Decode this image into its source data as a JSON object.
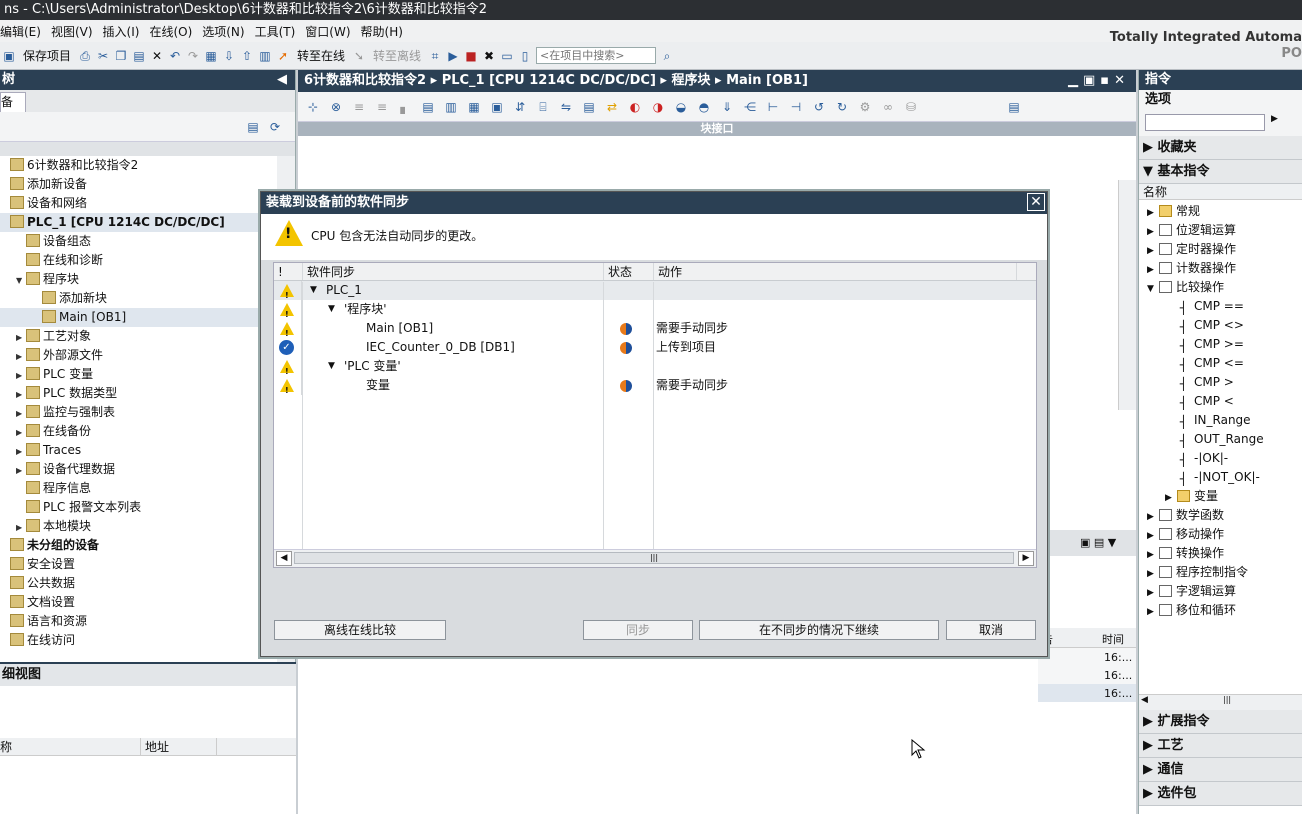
{
  "window": {
    "title": "ns  -  C:\\Users\\Administrator\\Desktop\\6计数器和比较指令2\\6计数器和比较指令2"
  },
  "menu": [
    "编辑(E)",
    "视图(V)",
    "插入(I)",
    "在线(O)",
    "选项(N)",
    "工具(T)",
    "窗口(W)",
    "帮助(H)"
  ],
  "toolbar": {
    "save_label": "保存项目",
    "go_online": "转至在线",
    "go_offline": "转至离线",
    "search_placeholder": "<在项目中搜索>"
  },
  "brand": {
    "line1": "Totally Integrated Automa",
    "line2": "PO"
  },
  "left_panel": {
    "header": "树",
    "tab": "备",
    "tree": [
      {
        "label": "6计数器和比较指令2",
        "indent": 0,
        "arrow": ""
      },
      {
        "label": "添加新设备",
        "indent": 0,
        "arrow": ""
      },
      {
        "label": "设备和网络",
        "indent": 0,
        "arrow": ""
      },
      {
        "label": "PLC_1 [CPU 1214C DC/DC/DC]",
        "indent": 0,
        "arrow": "",
        "bold": true,
        "selected": true
      },
      {
        "label": "设备组态",
        "indent": 1,
        "arrow": ""
      },
      {
        "label": "在线和诊断",
        "indent": 1,
        "arrow": ""
      },
      {
        "label": "程序块",
        "indent": 1,
        "arrow": "▼"
      },
      {
        "label": "添加新块",
        "indent": 2,
        "arrow": ""
      },
      {
        "label": "Main [OB1]",
        "indent": 2,
        "arrow": "",
        "selected": true
      },
      {
        "label": "工艺对象",
        "indent": 1,
        "arrow": "▶"
      },
      {
        "label": "外部源文件",
        "indent": 1,
        "arrow": "▶"
      },
      {
        "label": "PLC 变量",
        "indent": 1,
        "arrow": "▶"
      },
      {
        "label": "PLC 数据类型",
        "indent": 1,
        "arrow": "▶"
      },
      {
        "label": "监控与强制表",
        "indent": 1,
        "arrow": "▶"
      },
      {
        "label": "在线备份",
        "indent": 1,
        "arrow": "▶"
      },
      {
        "label": "Traces",
        "indent": 1,
        "arrow": "▶"
      },
      {
        "label": "设备代理数据",
        "indent": 1,
        "arrow": "▶"
      },
      {
        "label": "程序信息",
        "indent": 1,
        "arrow": ""
      },
      {
        "label": "PLC 报警文本列表",
        "indent": 1,
        "arrow": ""
      },
      {
        "label": "本地模块",
        "indent": 1,
        "arrow": "▶"
      },
      {
        "label": "未分组的设备",
        "indent": 0,
        "arrow": "",
        "bold": true
      },
      {
        "label": "安全设置",
        "indent": 0,
        "arrow": ""
      },
      {
        "label": "公共数据",
        "indent": 0,
        "arrow": ""
      },
      {
        "label": "文档设置",
        "indent": 0,
        "arrow": ""
      },
      {
        "label": "语言和资源",
        "indent": 0,
        "arrow": ""
      },
      {
        "label": "在线访问",
        "indent": 0,
        "arrow": ""
      }
    ]
  },
  "detail_view": {
    "header": "细视图",
    "col_name": "称",
    "col_addr": "地址"
  },
  "editor": {
    "breadcrumb": [
      "6计数器和比较指令2",
      "PLC_1 [CPU 1214C DC/DC/DC]",
      "程序块",
      "Main [OB1]"
    ],
    "block_interface": "块接口",
    "inspector_col_a": "告",
    "inspector_col_b": "时间",
    "times": [
      "16:...",
      "16:...",
      "16:..."
    ]
  },
  "right_panel": {
    "header": "指令",
    "options_label": "选项",
    "favorites": "收藏夹",
    "basic": "基本指令",
    "name_col": "名称",
    "items": [
      {
        "label": "常规",
        "indent": 0,
        "arrow": "▶",
        "icon": "folder-icon"
      },
      {
        "label": "位逻辑运算",
        "indent": 0,
        "arrow": "▶",
        "icon": "bitlogic-icon"
      },
      {
        "label": "定时器操作",
        "indent": 0,
        "arrow": "▶",
        "icon": "timer-icon"
      },
      {
        "label": "计数器操作",
        "indent": 0,
        "arrow": "▶",
        "icon": "counter-icon"
      },
      {
        "label": "比较操作",
        "indent": 0,
        "arrow": "▼",
        "icon": "compare-icon"
      },
      {
        "label": "CMP ==",
        "indent": 1,
        "arrow": "",
        "icon": "cmp-icon"
      },
      {
        "label": "CMP <>",
        "indent": 1,
        "arrow": "",
        "icon": "cmp-icon"
      },
      {
        "label": "CMP >=",
        "indent": 1,
        "arrow": "",
        "icon": "cmp-icon"
      },
      {
        "label": "CMP <=",
        "indent": 1,
        "arrow": "",
        "icon": "cmp-icon"
      },
      {
        "label": "CMP >",
        "indent": 1,
        "arrow": "",
        "icon": "cmp-icon"
      },
      {
        "label": "CMP <",
        "indent": 1,
        "arrow": "",
        "icon": "cmp-icon"
      },
      {
        "label": "IN_Range",
        "indent": 1,
        "arrow": "",
        "icon": "cmp-icon"
      },
      {
        "label": "OUT_Range",
        "indent": 1,
        "arrow": "",
        "icon": "cmp-icon"
      },
      {
        "label": "-|OK|-",
        "indent": 1,
        "arrow": "",
        "icon": "cmp-icon"
      },
      {
        "label": "-|NOT_OK|-",
        "indent": 1,
        "arrow": "",
        "icon": "cmp-icon"
      },
      {
        "label": "变量",
        "indent": 1,
        "arrow": "▶",
        "icon": "folder-icon"
      },
      {
        "label": "数学函数",
        "indent": 0,
        "arrow": "▶",
        "icon": "math-icon"
      },
      {
        "label": "移动操作",
        "indent": 0,
        "arrow": "▶",
        "icon": "move-icon"
      },
      {
        "label": "转换操作",
        "indent": 0,
        "arrow": "▶",
        "icon": "convert-icon"
      },
      {
        "label": "程序控制指令",
        "indent": 0,
        "arrow": "▶",
        "icon": "program-control-icon"
      },
      {
        "label": "字逻辑运算",
        "indent": 0,
        "arrow": "▶",
        "icon": "wordlogic-icon"
      },
      {
        "label": "移位和循环",
        "indent": 0,
        "arrow": "▶",
        "icon": "shift-icon"
      }
    ],
    "bottom_sections": [
      "扩展指令",
      "工艺",
      "通信",
      "选件包"
    ]
  },
  "dialog": {
    "title": "装载到设备前的软件同步",
    "close": "✕",
    "message": "CPU 包含无法自动同步的更改。",
    "columns": {
      "flag": "!",
      "sync": "软件同步",
      "status": "状态",
      "action": "动作"
    },
    "rows": [
      {
        "kind": "warn",
        "indent": 0,
        "arrow": "▼",
        "name": "PLC_1",
        "status": "",
        "action": ""
      },
      {
        "kind": "warn",
        "indent": 1,
        "arrow": "▼",
        "name": "'程序块'",
        "status": "",
        "action": ""
      },
      {
        "kind": "warn",
        "indent": 2,
        "arrow": "",
        "name": "Main [OB1]",
        "status": "half",
        "action": "需要手动同步"
      },
      {
        "kind": "ok",
        "indent": 2,
        "arrow": "",
        "name": "IEC_Counter_0_DB [DB1]",
        "status": "half",
        "action": "上传到项目"
      },
      {
        "kind": "warn",
        "indent": 1,
        "arrow": "▼",
        "name": "'PLC 变量'",
        "status": "",
        "action": ""
      },
      {
        "kind": "warn",
        "indent": 2,
        "arrow": "",
        "name": "变量",
        "status": "half",
        "action": "需要手动同步"
      }
    ],
    "buttons": {
      "compare": "离线在线比较",
      "sync": "同步",
      "continue": "在不同步的情况下继续",
      "cancel": "取消"
    }
  }
}
